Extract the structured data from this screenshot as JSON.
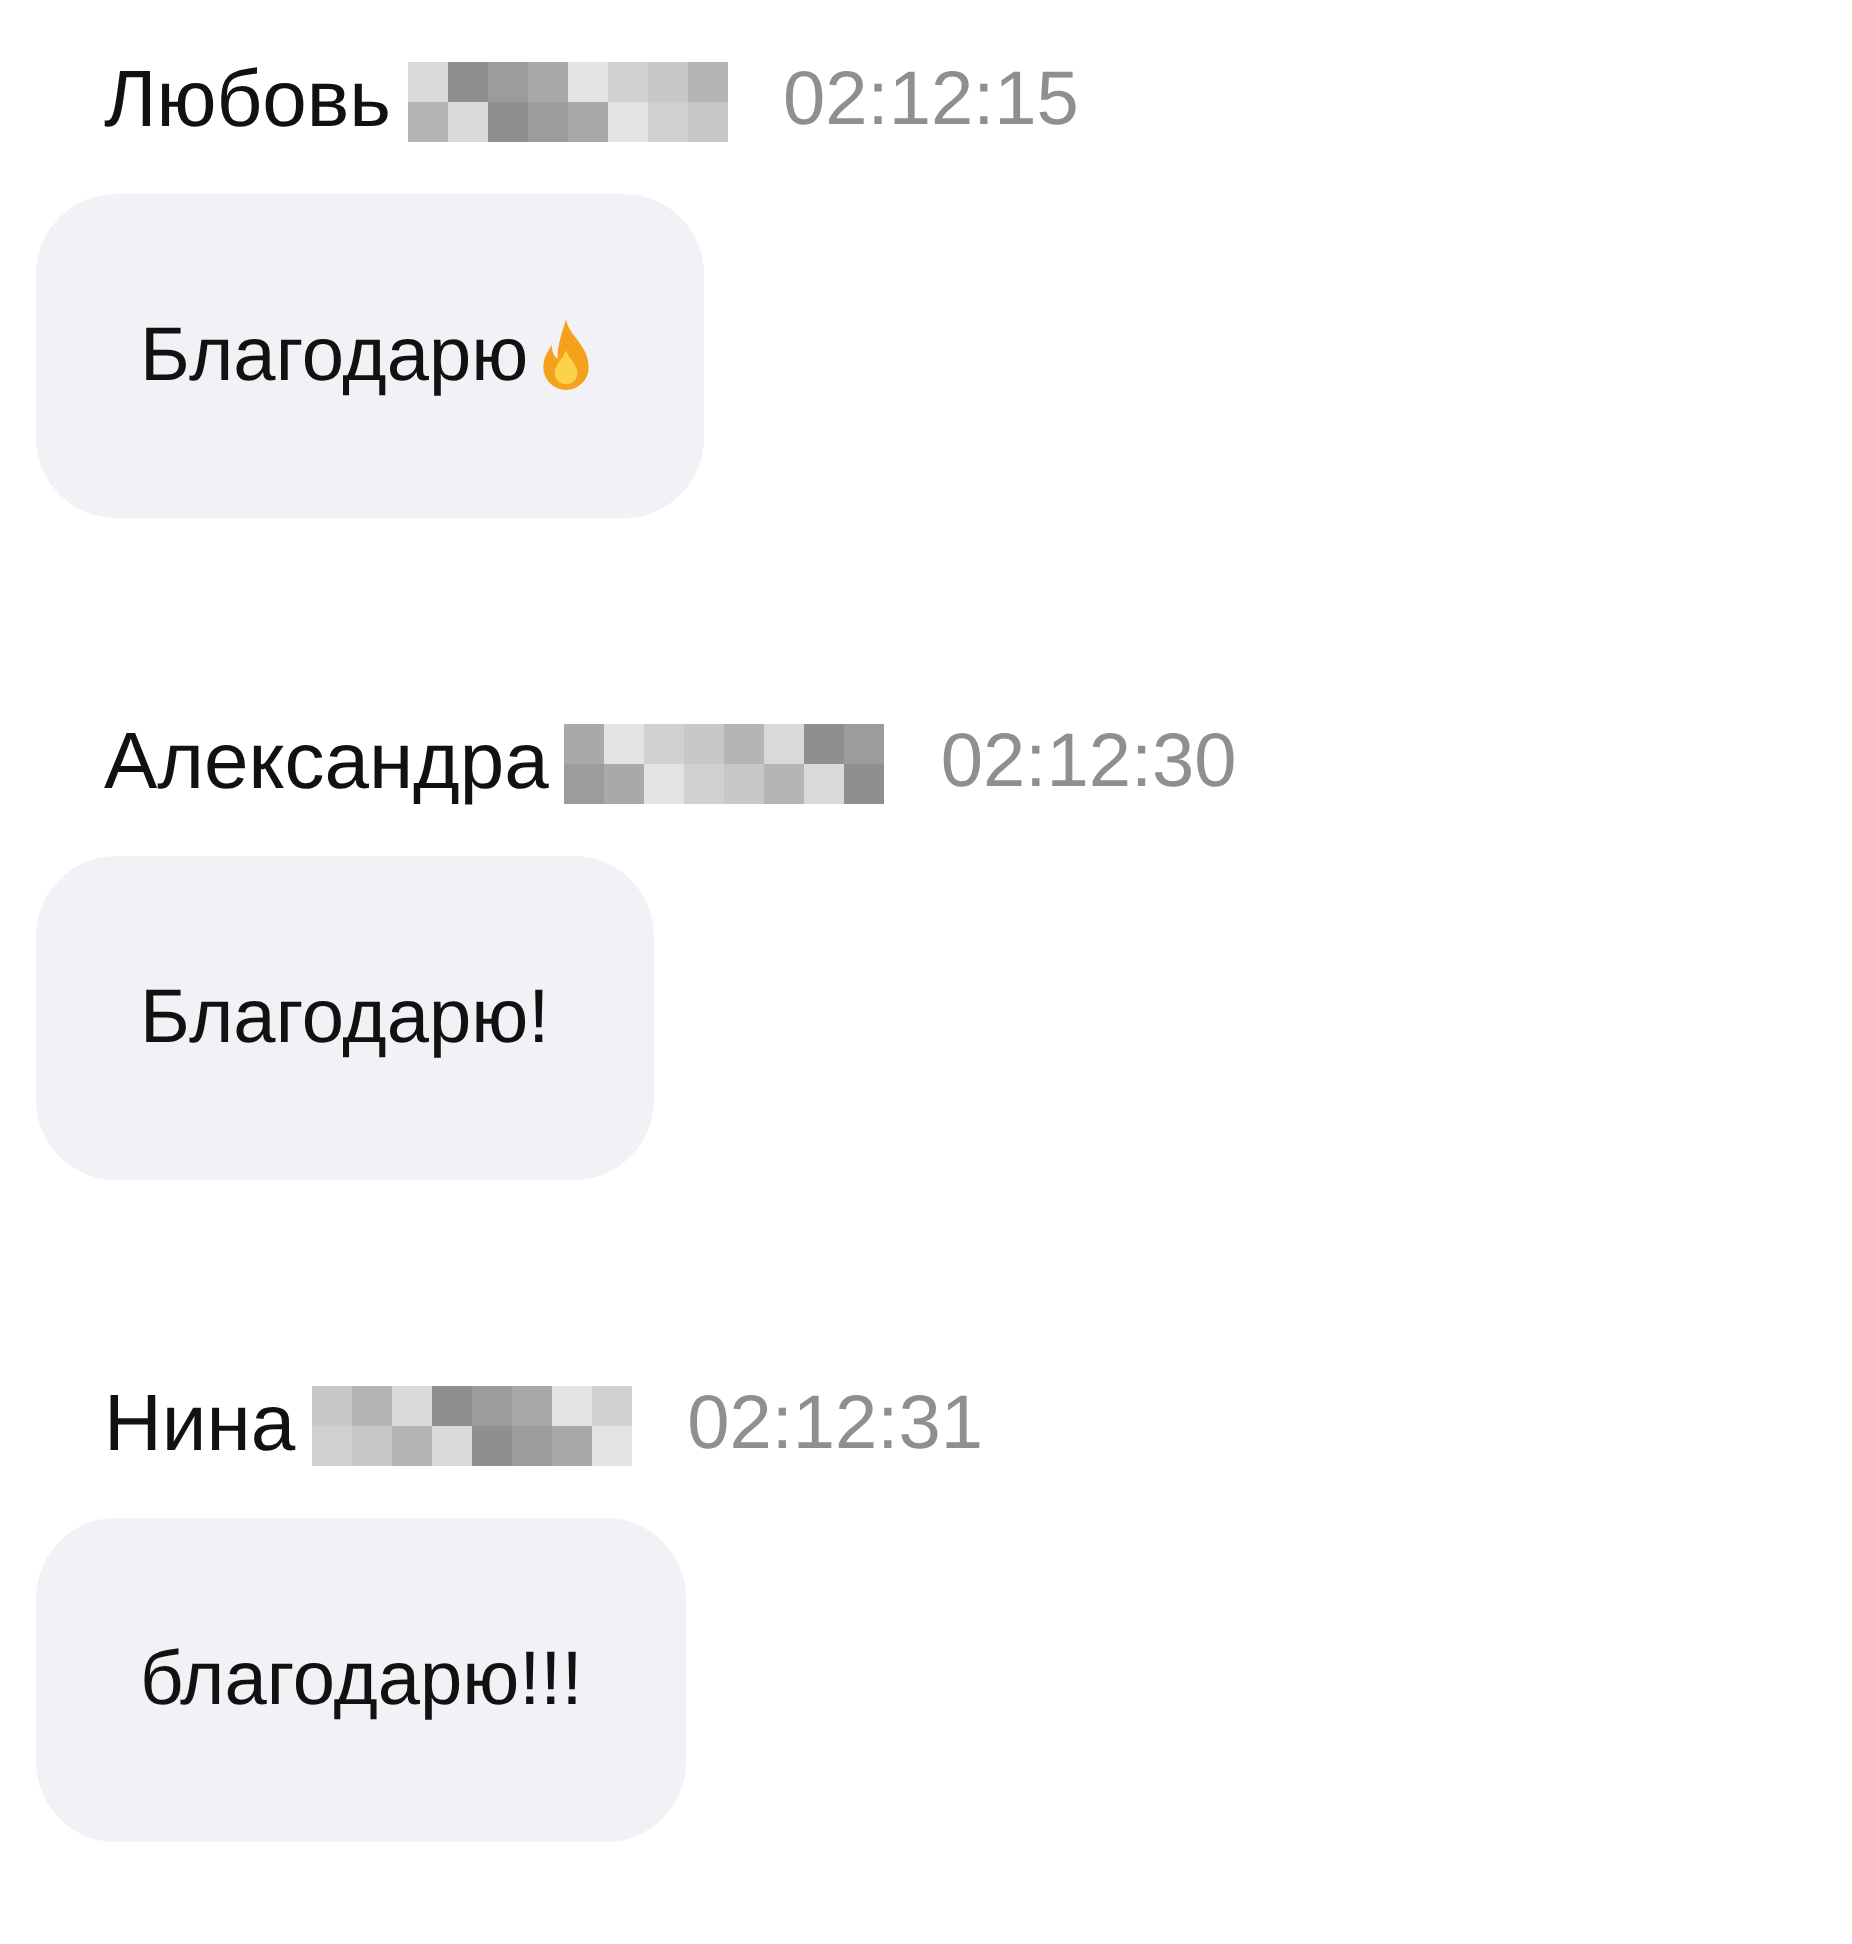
{
  "messages": [
    {
      "sender": "Любовь",
      "redacted": true,
      "time": "02:12:15",
      "text": "Благодарю",
      "trailing_icon": true
    },
    {
      "sender": "Александра",
      "redacted": true,
      "time": "02:12:30",
      "text": "Благодарю!",
      "trailing_icon": false
    },
    {
      "sender": "Нина",
      "redacted": true,
      "time": "02:12:31",
      "text": "благодарю!!!",
      "trailing_icon": false
    }
  ]
}
